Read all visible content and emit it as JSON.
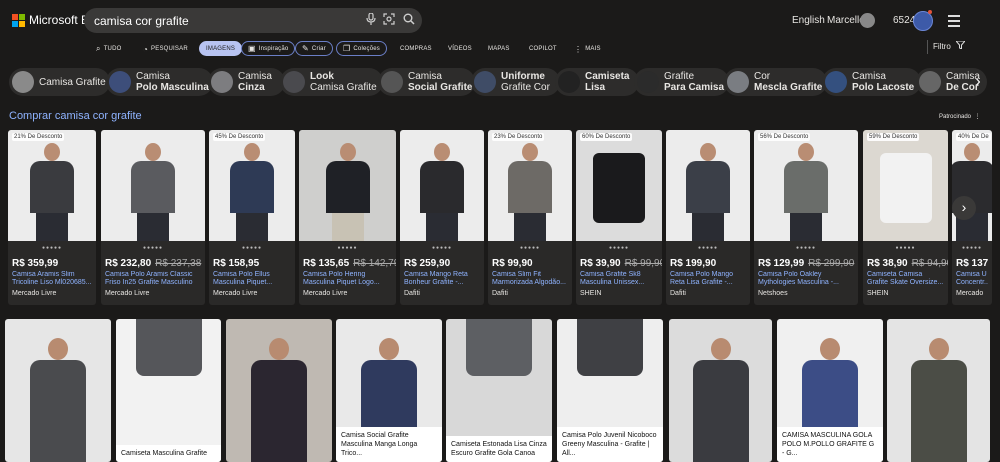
{
  "header": {
    "brand": "Microsoft Bing",
    "query": "camisa cor grafite",
    "language": "English",
    "user": "Marcello",
    "points": "6524"
  },
  "tabs": [
    {
      "label": "TUDO",
      "icon": "search-icon"
    },
    {
      "label": "PESQUISAR",
      "icon": "copilot-icon"
    },
    {
      "label": "IMAGENS",
      "icon": "",
      "active": true
    },
    {
      "label": "Inspiração",
      "icon": "image-icon",
      "pill": true
    },
    {
      "label": "Criar",
      "icon": "brush-icon",
      "pill": true
    },
    {
      "label": "Coleções",
      "icon": "collection-icon",
      "pill": true
    },
    {
      "label": "COMPRAS",
      "icon": ""
    },
    {
      "label": "VÍDEOS",
      "icon": ""
    },
    {
      "label": "MAPAS",
      "icon": ""
    },
    {
      "label": "COPILOT",
      "icon": ""
    },
    {
      "label": "MAIS",
      "icon": "more-icon"
    }
  ],
  "filter_label": "Filtro",
  "chips": [
    {
      "line1": "Camisa Grafite",
      "line2": "",
      "bold": ""
    },
    {
      "line1": "Camisa",
      "line2": "Polo Masculina",
      "bold": "2"
    },
    {
      "line1": "Camisa",
      "line2": "Cinza",
      "bold": "2"
    },
    {
      "line1": "Look",
      "line2": "Camisa Grafite",
      "bold": "1"
    },
    {
      "line1": "Camisa",
      "line2": "Social Grafite",
      "bold": "2"
    },
    {
      "line1": "Uniforme",
      "line2": "Grafite Cor",
      "bold": "1"
    },
    {
      "line1": "Camiseta",
      "line2": "Lisa",
      "bold": "both"
    },
    {
      "line1": "Grafite",
      "line2": "Para Camisa",
      "bold": "2"
    },
    {
      "line1": "Cor",
      "line2": "Mescla Grafite",
      "bold": "2"
    },
    {
      "line1": "Camisa",
      "line2": "Polo Lacoste",
      "bold": "2"
    },
    {
      "line1": "Camisa",
      "line2": "De Cor",
      "bold": "2"
    }
  ],
  "shopping": {
    "title": "Comprar camisa cor grafite",
    "sponsored": "Patrocinado",
    "products": [
      {
        "discount": "21% De Desconto",
        "price": "R$ 359,99",
        "old": "",
        "name": "Camisa Aramis Slim Tricoline Liso Ml020685...",
        "store": "Mercado Livre",
        "color": "#3a3b3f"
      },
      {
        "discount": "",
        "price": "R$ 232,80",
        "old": "R$ 237,38",
        "name": "Camisa Polo Aramis Classic Friso In25 Grafite Masculino",
        "store": "Mercado Livre",
        "color": "#5a5b5f"
      },
      {
        "discount": "45% De Desconto",
        "price": "R$ 158,95",
        "old": "",
        "name": "Camisa Polo Ellus Masculina Piquet...",
        "store": "Mercado Livre",
        "color": "#2e3a55"
      },
      {
        "discount": "",
        "price": "R$ 135,65",
        "old": "R$ 142,79",
        "name": "Camisa Polo Hering Masculina Piquet Logo...",
        "store": "Mercado Livre",
        "color": "#1f2126"
      },
      {
        "discount": "",
        "price": "R$ 259,90",
        "old": "",
        "name": "Camisa Mango Reta Bonheur Grafite -...",
        "store": "Dafiti",
        "color": "#2a2a2d"
      },
      {
        "discount": "23% De Desconto",
        "price": "R$ 99,90",
        "old": "",
        "name": "Camisa Slim Fit Marmorizada Algodão...",
        "store": "Dafiti",
        "color": "#6d6a66"
      },
      {
        "discount": "60% De Desconto",
        "price": "R$ 39,90",
        "old": "R$ 99,90",
        "name": "Camisa Grafite Sk8 Masculina Unissex...",
        "store": "SHEIN",
        "color": "#1a1a1c"
      },
      {
        "discount": "",
        "price": "R$ 199,90",
        "old": "",
        "name": "Camisa Polo Mango Reta Lisa Grafite -...",
        "store": "Dafiti",
        "color": "#3b3f48"
      },
      {
        "discount": "56% De Desconto",
        "price": "R$ 129,99",
        "old": "R$ 299,90",
        "name": "Camisa Polo Oakley Mythologies Masculina -...",
        "store": "Netshoes",
        "color": "#6a6d6a"
      },
      {
        "discount": "59% De Desconto",
        "price": "R$ 38,90",
        "old": "R$ 94,90",
        "name": "Camiseta Camisa Grafite Skate Oversize...",
        "store": "SHEIN",
        "color": "#f2f2f2"
      },
      {
        "discount": "40% De De",
        "price": "R$ 137",
        "old": "",
        "name": "Camisa U Concentr...",
        "store": "Mercado",
        "color": "#2b2b2e"
      }
    ]
  },
  "images": [
    {
      "caption": "",
      "color": "#4a4b4e",
      "bg": "#e6e6e6"
    },
    {
      "caption": "Camiseta Masculina Grafite",
      "color": "#55565a",
      "bg": "#f2f2f2"
    },
    {
      "caption": "",
      "color": "#2b2630",
      "bg": "#bfb9b2"
    },
    {
      "caption": "Camisa Social Grafite Masculina Manga Longa Trico...",
      "color": "#2f3a5e",
      "bg": "#e9e9e9"
    },
    {
      "caption": "Camiseta Estonada Lisa Cinza Escuro Grafite Gola Canoa",
      "color": "#5d5f63",
      "bg": "#d8d8d8"
    },
    {
      "caption": "Camisa Polo Juvenil Nicoboco Greeny Masculina - Grafite | All...",
      "color": "#3f4044",
      "bg": "#eeeeee"
    },
    {
      "caption": "",
      "color": "#3a3b40",
      "bg": "#dcdcdc"
    },
    {
      "caption": "CAMISA MASCULINA GOLA POLO M.POLLO GRAFITE G - G...",
      "color": "#3c4d86",
      "bg": "#f0f0f0"
    },
    {
      "caption": "",
      "color": "#4b4d46",
      "bg": "#e4e4e4"
    }
  ]
}
